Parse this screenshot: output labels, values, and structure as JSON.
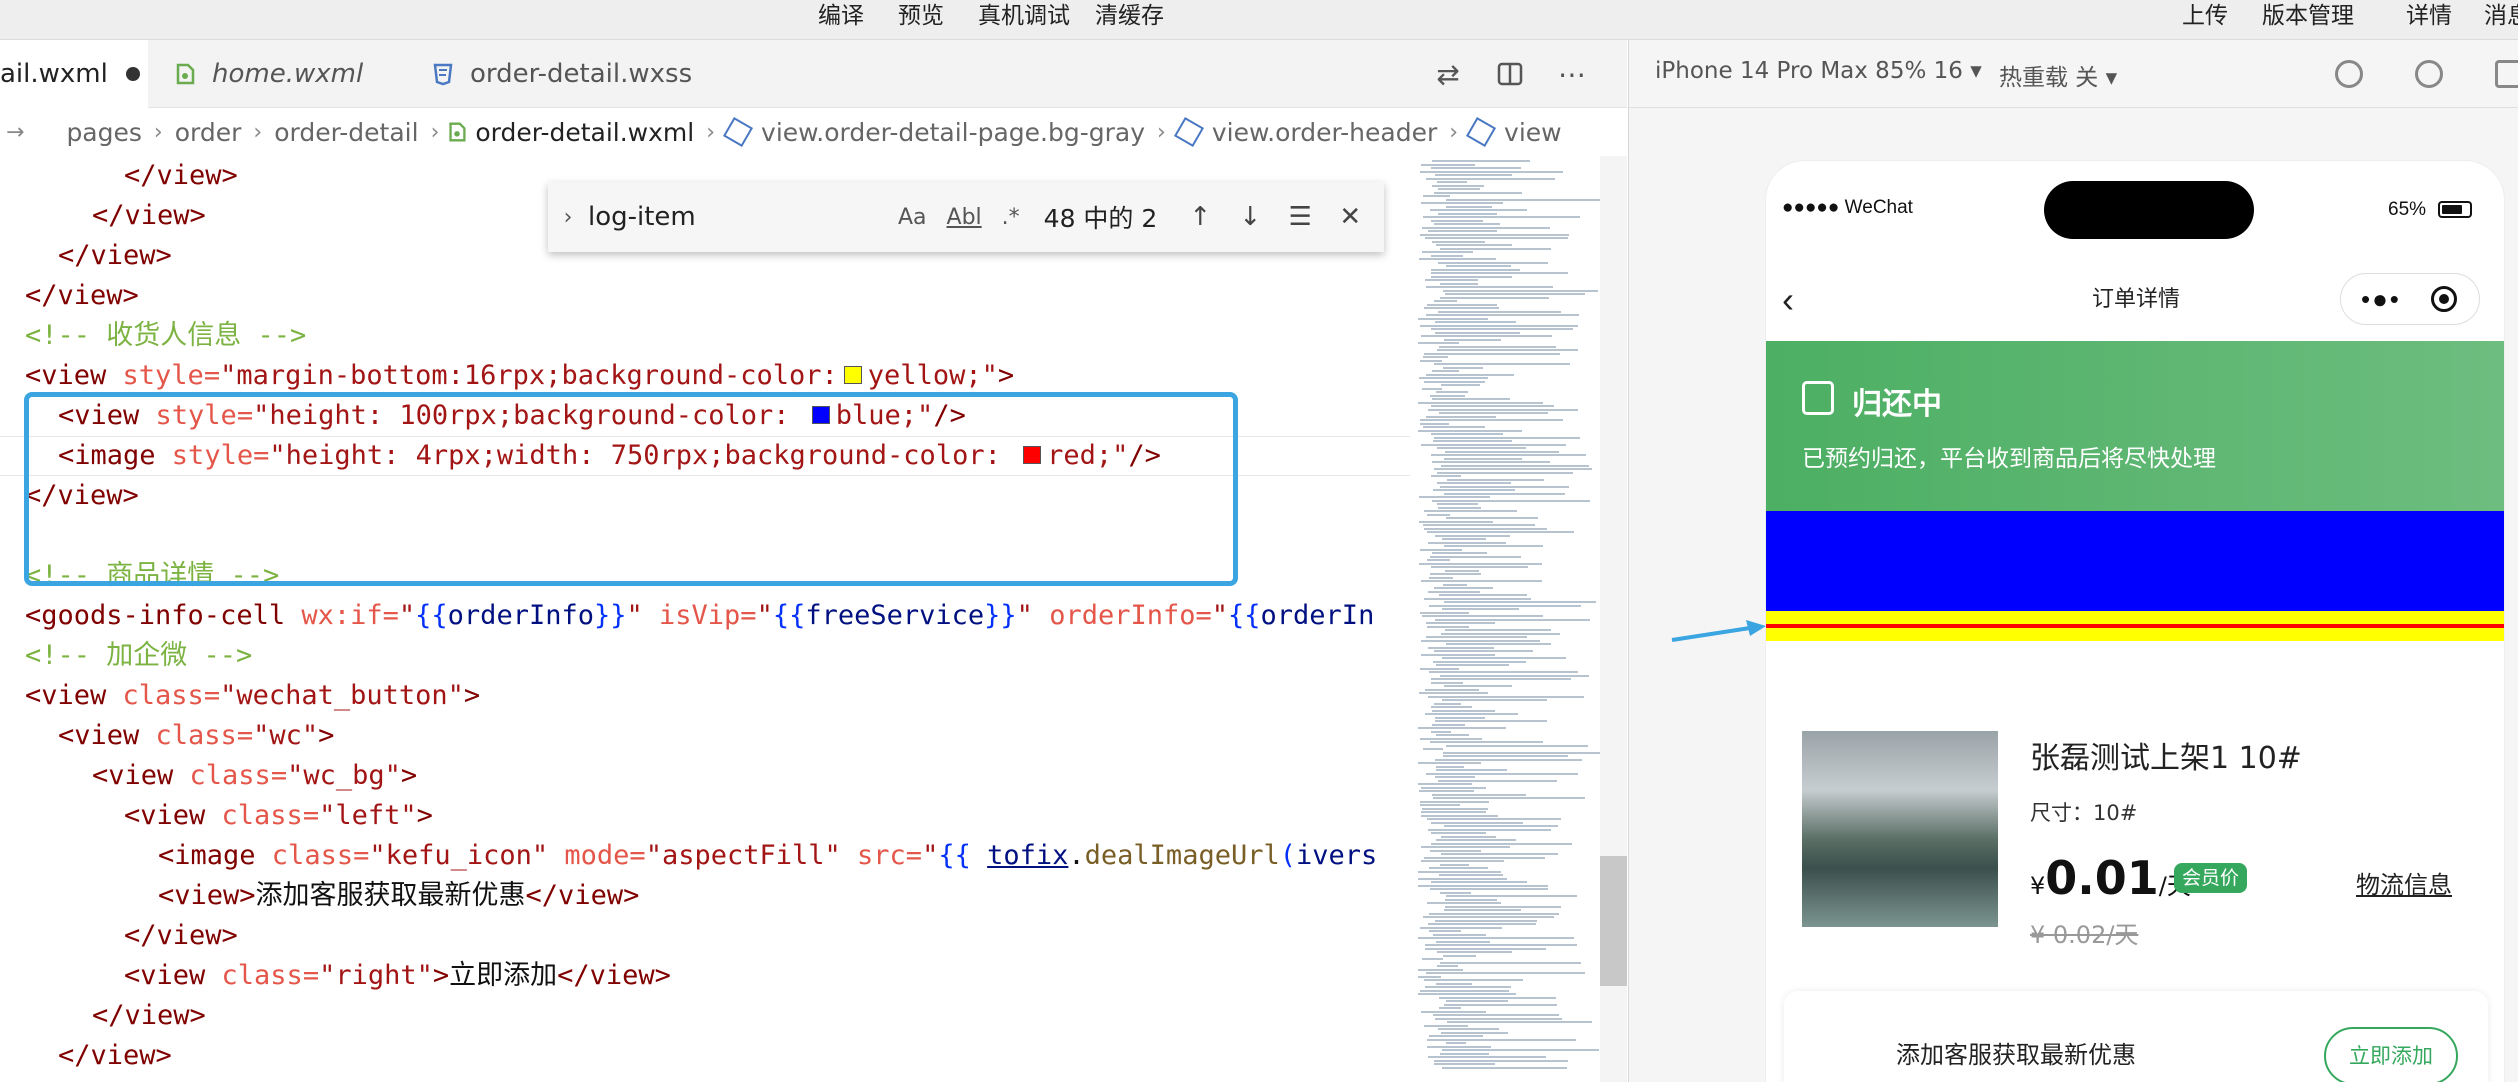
{
  "toolbar": {
    "compile": "编译",
    "preview": "预览",
    "remote_debug": "真机调试",
    "clear_cache": "清缓存",
    "upload": "上传",
    "version_mgmt": "版本管理",
    "details": "详情",
    "messages": "消息"
  },
  "tabs": [
    {
      "label": "ail.wxml"
    },
    {
      "label": "home.wxml"
    },
    {
      "label": "order-detail.wxss"
    }
  ],
  "breadcrumb": {
    "items": [
      "pages",
      "order",
      "order-detail",
      "order-detail.wxml",
      "view.order-detail-page.bg-gray",
      "view.order-header",
      "view"
    ]
  },
  "find": {
    "query": "log-item",
    "match_case": "Aa",
    "whole_word": "Abl",
    "regex": ".*",
    "count": "48 中的 2"
  },
  "code": {
    "l1": "</view>",
    "l2": "</view>",
    "l3": "</view>",
    "l4": "</view>",
    "c1": "<!-- 收货人信息 -->",
    "l6_open": "<view",
    "l6_attr": " style=",
    "l6_val1": "\"margin-bottom:16rpx;background-color:",
    "l6_val2": "yellow;\"",
    "l6_close": ">",
    "l7_open": "<view",
    "l7_attr": " style=",
    "l7_val1": "\"height: 100rpx;background-color: ",
    "l7_val2": "blue;\"",
    "l7_close": "/>",
    "l8_open": "<image",
    "l8_attr": " style=",
    "l8_val1": "\"height: 4rpx;width: 750rpx;background-color: ",
    "l8_val2": "red;\"",
    "l8_close": "/>",
    "l9": "</view>",
    "c2": "<!-- 商品详情 -->",
    "l11_tag": "<goods-info-cell",
    "l11_a1": " wx:if=",
    "l11_v1a": "\"",
    "l11_v1b": "{{",
    "l11_v1c": "orderInfo",
    "l11_v1d": "}}",
    "l11_v1e": "\"",
    "l11_a2": " isVip=",
    "l11_v2a": "\"",
    "l11_v2b": "{{",
    "l11_v2c": "freeService",
    "l11_v2d": "}}",
    "l11_v2e": "\"",
    "l11_a3": " orderInfo=",
    "l11_v3a": "\"",
    "l11_v3b": "{{",
    "l11_v3c": "orderIn",
    "c3": "<!-- 加企微 -->",
    "l13_tag": "<view",
    "l13_attr": " class=",
    "l13_val": "\"wechat_button\"",
    "l13_close": ">",
    "l14_tag": "<view",
    "l14_attr": " class=",
    "l14_val": "\"wc\"",
    "l14_close": ">",
    "l15_tag": "<view",
    "l15_attr": " class=",
    "l15_val": "\"wc_bg\"",
    "l15_close": ">",
    "l16_tag": "<view",
    "l16_attr": " class=",
    "l16_val": "\"left\"",
    "l16_close": ">",
    "l17_tag": "<image",
    "l17_a1": " class=",
    "l17_v1": "\"kefu_icon\"",
    "l17_a2": " mode=",
    "l17_v2": "\"aspectFill\"",
    "l17_a3": " src=",
    "l17_v3a": "\"",
    "l17_v3b": "{{ ",
    "l17_v3c": "tofix",
    "l17_v3d": ".",
    "l17_v3e": "dealImageUrl",
    "l17_v3f": "(",
    "l17_v3g": "ivers",
    "l18_open": "<view",
    "l18_gt": ">",
    "l18_text": "添加客服获取最新优惠",
    "l18_close": "</view>",
    "l19": "</view>",
    "l20_tag": "<view",
    "l20_attr": " class=",
    "l20_val": "\"right\"",
    "l20_gt": ">",
    "l20_text": "立即添加",
    "l20_close": "</view>",
    "l21": "</view>",
    "l22": "</view>"
  },
  "simulator": {
    "device": "iPhone 14 Pro Max 85% 16 ▾",
    "hot_reload": "热重载 关 ▾"
  },
  "phone": {
    "carrier": "●●●●● WeChat",
    "battery": "65%",
    "nav_title": "订单详情",
    "status_title": "归还中",
    "status_desc": "已预约归还，平台收到商品后将尽快处理",
    "goods_name": "张磊测试上架1 10#",
    "goods_spec": "尺寸：10#",
    "price_currency": "¥",
    "price_value": "0.01",
    "price_unit": "/天",
    "vip_badge": "会员价",
    "orig_price": "¥ 0.02/天",
    "logistics": "物流信息",
    "service_text": "添加客服获取最新优惠",
    "service_button": "立即添加"
  },
  "colors": {
    "highlight_border": "#3aa5e0",
    "status_green": "#4caf63",
    "block_blue": "#0000ff",
    "block_yellow": "#ffff00",
    "line_red": "#ff0000"
  }
}
